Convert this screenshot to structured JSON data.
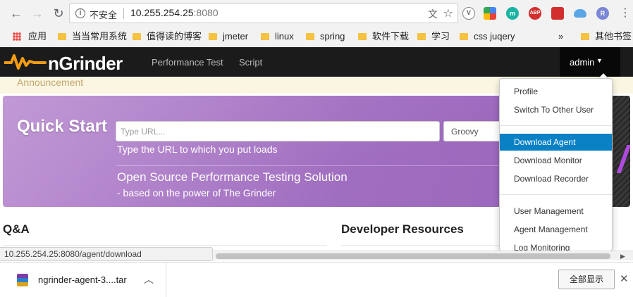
{
  "browser": {
    "insecure_label": "不安全",
    "url_host": "10.255.254.25",
    "url_port": ":8080",
    "bookmarks": [
      "应用",
      "当当常用系统",
      "值得读的博客",
      "jmeter",
      "linux",
      "spring",
      "软件下载",
      "学习",
      "css juqery",
      "其他书签"
    ],
    "bookmarks_overflow": "»",
    "extensions": [
      "V",
      "m",
      "ABP",
      "R"
    ]
  },
  "app": {
    "brand": "nGrinder",
    "nav": [
      "Performance Test",
      "Script"
    ],
    "user": "admin",
    "announcement": "Announcement"
  },
  "quick_start": {
    "title": "Quick Start",
    "url_placeholder": "Type URL...",
    "language": "Groovy",
    "hint": "Type the URL to which you put loads",
    "tagline": "Open Source Performance Testing Solution",
    "sub_tagline": "- based on the power of The Grinder"
  },
  "sections": {
    "qa": "Q&A",
    "dev": "Developer Resources"
  },
  "dropdown": {
    "items": [
      "Profile",
      "Switch To Other User",
      "Download Agent",
      "Download Monitor",
      "Download Recorder",
      "User Management",
      "Agent Management",
      "Log Monitoring"
    ],
    "active": "Download Agent"
  },
  "status_url": "10.255.254.25:8080/agent/download",
  "download": {
    "filename": "ngrinder-agent-3....tar",
    "show_all": "全部显示"
  },
  "colors": {
    "hero_purple": "#a06ec0",
    "menu_active": "#0a81c5",
    "nav_dark": "#1b1b1b",
    "brand_orange": "#f39c12"
  }
}
